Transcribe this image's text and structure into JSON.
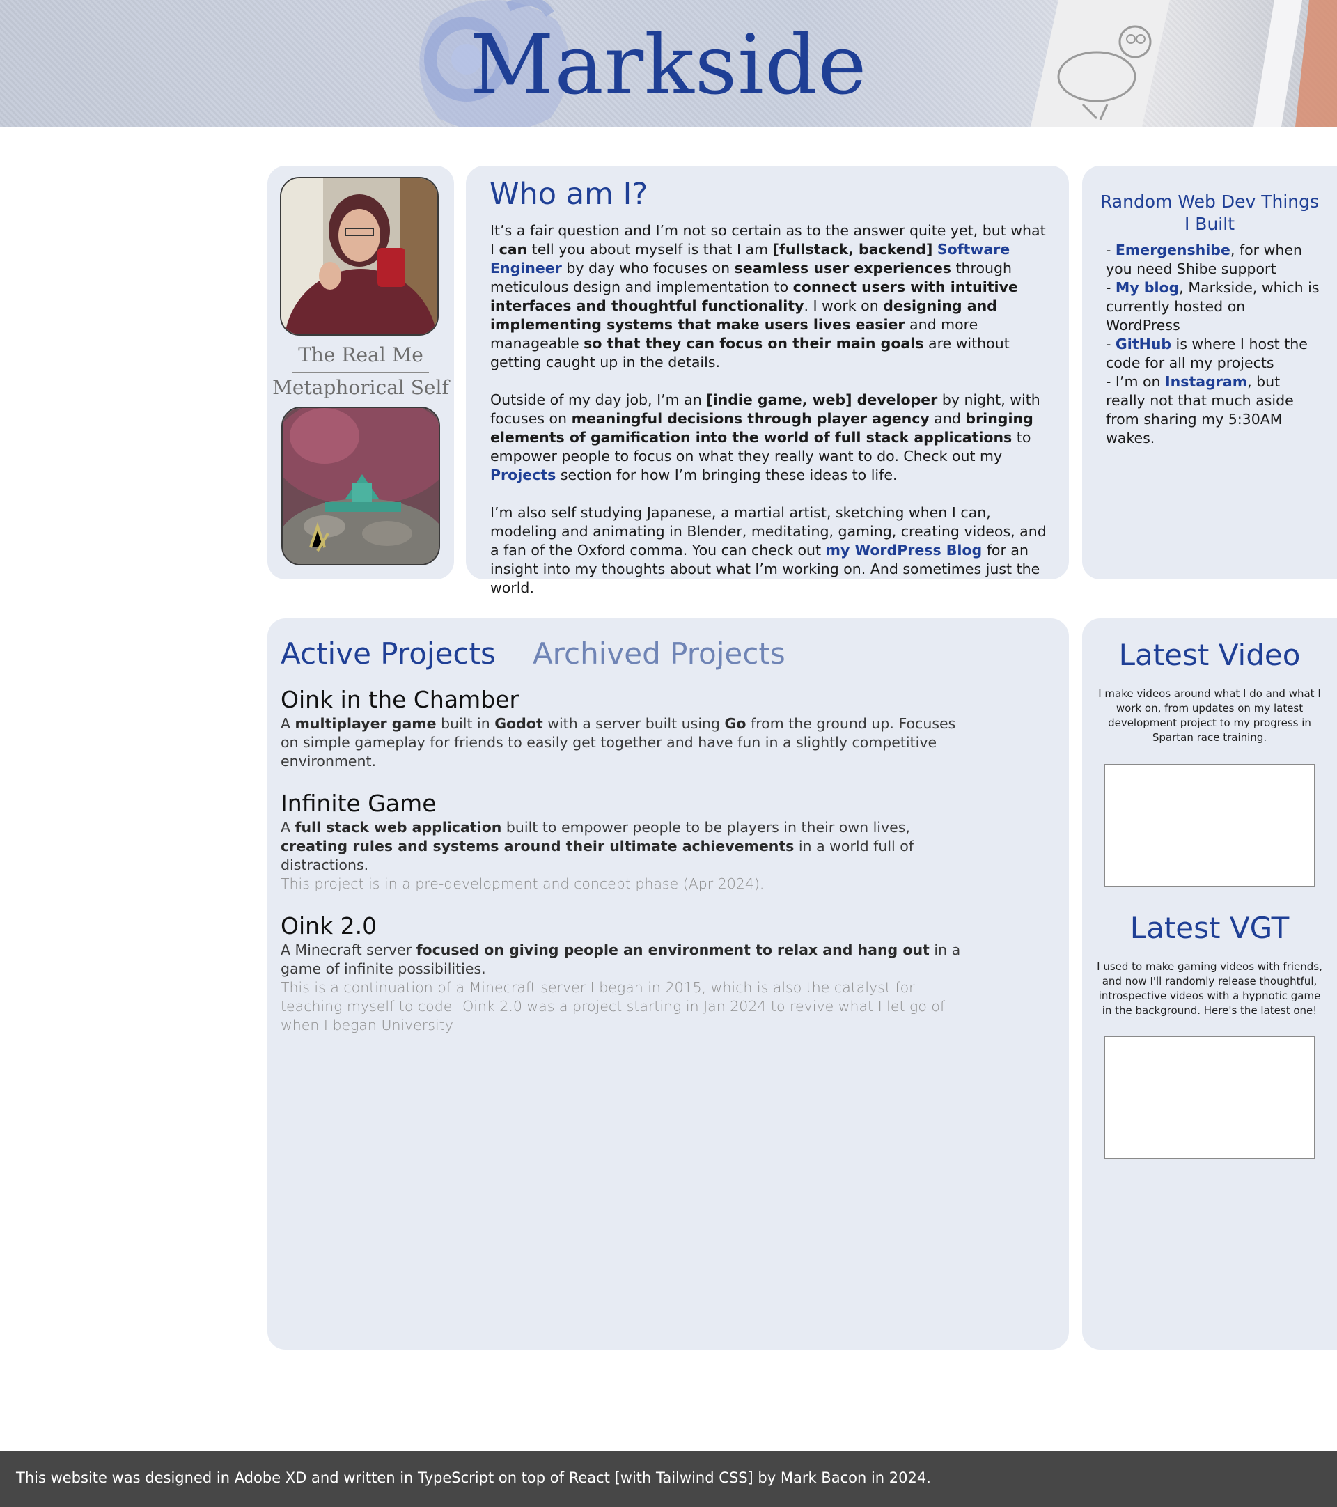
{
  "header": {
    "title": "Markside"
  },
  "profile": {
    "real_caption": "The Real Me",
    "metaphorical_caption": "Metaphorical Self"
  },
  "who": {
    "heading": "Who am I?",
    "p1": {
      "t1": "It’s a fair question and I’m not so certain as to the answer quite yet, but what I ",
      "b1": "can",
      "t2": " tell you about myself is that I am ",
      "b2": "[fullstack, backend]",
      "t3": " ",
      "link1": "Software Engineer",
      "t4": " by day who focuses on ",
      "b3": "seamless user experiences",
      "t5": " through meticulous design and implementation to ",
      "b4": "connect users with intuitive interfaces and thoughtful functionality",
      "t6": ". I work on ",
      "b5": "designing and implementing systems that make users lives easier",
      "t7": " and more manageable ",
      "b6": "so that they can focus on their main goals",
      "t8": " are without getting caught up in the details."
    },
    "p2": {
      "t1": "Outside of my day job, I’m an ",
      "b1": "[indie game, web] developer",
      "t2": " by night, with focuses on ",
      "b2": "meaningful decisions through player agency",
      "t3": " and ",
      "b3": "bringing elements of gamification into the world of full stack applications",
      "t4": " to empower people to focus on what they really want to do. Check out my ",
      "link1": "Projects",
      "t5": " section for how I’m bringing these ideas to life."
    },
    "p3": {
      "t1": "I’m also self studying Japanese, a martial artist, sketching when I can, modeling and animating in Blender, meditating, gaming, creating videos, and a fan of the Oxford comma. You can check out ",
      "link1": "my WordPress Blog",
      "t2": " for an insight into my thoughts about what I’m working on. And sometimes just the world."
    }
  },
  "random": {
    "heading": "Random Web Dev Things I Built",
    "items": [
      {
        "prefix": "- ",
        "link": "Emergenshibe",
        "text": ", for when you need Shibe support"
      },
      {
        "prefix": "- ",
        "link": "My blog",
        "text": ", Markside, which is currently hosted on WordPress"
      },
      {
        "prefix": "- ",
        "link": "GitHub",
        "text": " is where I host the code for all my projects"
      },
      {
        "prefix": "- I’m on ",
        "link": "Instagram",
        "text": ", but really not that much aside from sharing my 5:30AM wakes."
      }
    ]
  },
  "projects": {
    "tab_active": "Active Projects",
    "tab_archived": "Archived Projects",
    "items": [
      {
        "title": "Oink in the Chamber",
        "d1": "A ",
        "b1": "multiplayer game",
        "d2": " built in ",
        "b2": "Godot",
        "d3": " with a server built using ",
        "b3": "Go",
        "d4": " from the ground up. Focuses on simple gameplay for friends to easily get together and have fun in a slightly competitive environment.",
        "note": ""
      },
      {
        "title": "Infinite Game",
        "d1": "A ",
        "b1": "full stack web application",
        "d2": " built to empower people to be players in their own lives, ",
        "b2": "creating rules and systems around their ultimate achievements",
        "d3": " in a world full of distractions.",
        "b3": "",
        "d4": "",
        "note": "This project is in a pre-development and concept phase (Apr 2024)."
      },
      {
        "title": "Oink 2.0",
        "d1": "A Minecraft server ",
        "b1": "focused on giving people an environment to relax and hang out",
        "d2": " in a game of infinite possibilities.",
        "b2": "",
        "d3": "",
        "b3": "",
        "d4": "",
        "note": "This is a continuation of a Minecraft server I began in 2015, which is also the catalyst for teaching myself to code! Oink 2.0 was a project starting in Jan 2024 to revive what I let go of when I began University"
      }
    ]
  },
  "video": {
    "latest_video_heading": "Latest Video",
    "latest_video_text": "I make videos around what I do and what I work on, from updates on my latest development project to my progress in Spartan race training.",
    "latest_vgt_heading": "Latest VGT",
    "latest_vgt_text": "I used to make gaming videos with friends, and now I'll randomly release thoughtful, introspective videos with a hypnotic game in the background. Here's the latest one!"
  },
  "footer": {
    "text": "This website was designed in Adobe XD and written in TypeScript on top of React [with Tailwind CSS] by Mark Bacon in 2024."
  },
  "colors": {
    "accent": "#1f3f95",
    "card": "#e7ebf3",
    "footer": "#474747"
  }
}
